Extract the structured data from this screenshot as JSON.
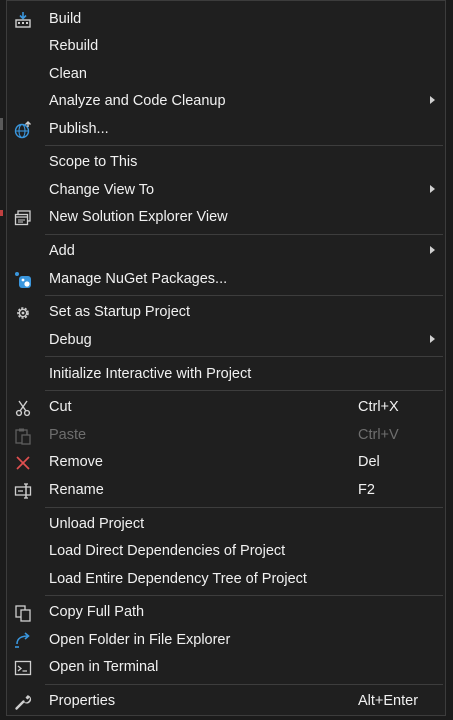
{
  "menu": {
    "items": [
      {
        "label": "Build",
        "icon": "build-icon"
      },
      {
        "label": "Rebuild"
      },
      {
        "label": "Clean"
      },
      {
        "label": "Analyze and Code Cleanup",
        "submenu": true
      },
      {
        "label": "Publish...",
        "icon": "publish-globe-icon"
      },
      {
        "label": "Scope to This"
      },
      {
        "label": "Change View To",
        "submenu": true
      },
      {
        "label": "New Solution Explorer View",
        "icon": "new-window-icon"
      },
      {
        "label": "Add",
        "submenu": true
      },
      {
        "label": "Manage NuGet Packages...",
        "icon": "nuget-icon"
      },
      {
        "label": "Set as Startup Project",
        "icon": "gear-icon"
      },
      {
        "label": "Debug",
        "submenu": true
      },
      {
        "label": "Initialize Interactive with Project"
      },
      {
        "label": "Cut",
        "shortcut": "Ctrl+X",
        "icon": "scissors-icon"
      },
      {
        "label": "Paste",
        "shortcut": "Ctrl+V",
        "icon": "clipboard-icon",
        "disabled": true
      },
      {
        "label": "Remove",
        "shortcut": "Del",
        "icon": "close-x-icon"
      },
      {
        "label": "Rename",
        "shortcut": "F2",
        "icon": "rename-icon"
      },
      {
        "label": "Unload Project"
      },
      {
        "label": "Load Direct Dependencies of Project"
      },
      {
        "label": "Load Entire Dependency Tree of Project"
      },
      {
        "label": "Copy Full Path",
        "icon": "copy-icon"
      },
      {
        "label": "Open Folder in File Explorer",
        "icon": "folder-arrow-icon"
      },
      {
        "label": "Open in Terminal",
        "icon": "terminal-icon"
      },
      {
        "label": "Properties",
        "shortcut": "Alt+Enter",
        "icon": "wrench-icon"
      }
    ]
  },
  "colors": {
    "background": "#1f1f1f",
    "text": "#f1f1f1",
    "disabled_text": "#6e6e6e",
    "separator": "#3d3d3d",
    "accent_blue": "#3a96dd",
    "remove_red": "#e05050"
  }
}
